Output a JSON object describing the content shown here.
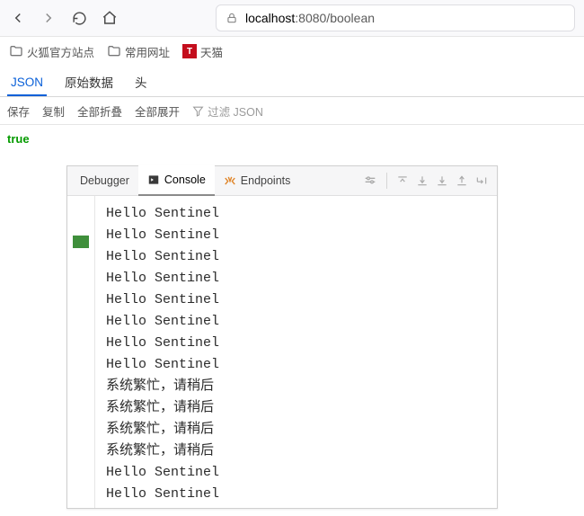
{
  "browser": {
    "url_display_prefix": "localhost",
    "url_display_rest": ":8080/boolean",
    "bookmarks": [
      {
        "label": "火狐官方站点",
        "kind": "folder"
      },
      {
        "label": "常用网址",
        "kind": "folder"
      },
      {
        "label": "天猫",
        "kind": "favicon"
      }
    ]
  },
  "json_viewer": {
    "tabs": {
      "json": "JSON",
      "raw": "原始数据",
      "headers": "头"
    },
    "toolbar": {
      "save": "保存",
      "copy": "复制",
      "collapse_all": "全部折叠",
      "expand_all": "全部展开",
      "filter_placeholder": "过滤 JSON"
    },
    "value": "true"
  },
  "ide": {
    "tabs": {
      "debugger": "Debugger",
      "console": "Console",
      "endpoints": "Endpoints"
    },
    "console_lines": [
      "Hello Sentinel",
      "Hello Sentinel",
      "Hello Sentinel",
      "Hello Sentinel",
      "Hello Sentinel",
      "Hello Sentinel",
      "Hello Sentinel",
      "Hello Sentinel",
      "系统繁忙，请稍后",
      "系统繁忙，请稍后",
      "系统繁忙，请稍后",
      "系统繁忙，请稍后",
      "Hello Sentinel",
      "Hello Sentinel"
    ]
  }
}
